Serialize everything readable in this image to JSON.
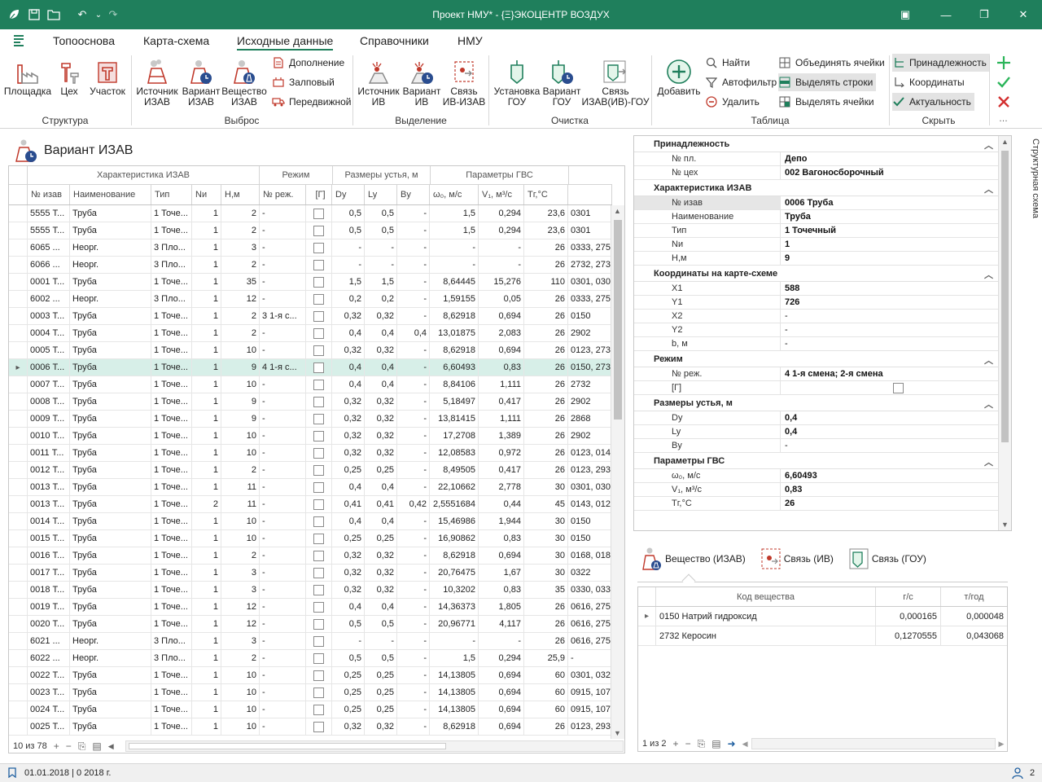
{
  "window": {
    "title": "Проект НМУ* - {Ξ}ЭКОЦЕНТР ВОЗДУХ"
  },
  "menu_tabs": [
    "Топооснова",
    "Карта-схема",
    "Исходные данные",
    "Справочники",
    "НМУ"
  ],
  "ribbon": {
    "groups": {
      "structure": "Структура",
      "emission": "Выброс",
      "selection": "Выделение",
      "cleaning": "Очистка",
      "table": "Таблица",
      "hide": "Скрыть"
    },
    "buttons": {
      "area": "Площадка",
      "shop": "Цех",
      "section": "Участок",
      "source_izav": "Источник ИЗАВ",
      "variant_izav": "Вариант ИЗАВ",
      "substance_izav": "Вещество ИЗАВ",
      "addition": "Дополнение",
      "salvo": "Залповый",
      "mobile": "Передвижной",
      "source_iv": "Источник ИВ",
      "variant_iv": "Вариант ИВ",
      "link_iv_izav": "Связь ИВ-ИЗАВ",
      "install_gou": "Установка ГОУ",
      "variant_gou": "Вариант ГОУ",
      "link_izav_gou": "Связь ИЗАВ(ИВ)-ГОУ",
      "add": "Добавить",
      "find": "Найти",
      "autofilter": "Автофильтр",
      "delete": "Удалить",
      "merge_cells": "Объединять ячейки",
      "select_rows": "Выделять строки",
      "select_cells": "Выделять ячейки",
      "belonging": "Принадлежность",
      "coordinates": "Координаты",
      "actuality": "Актуальность"
    }
  },
  "main": {
    "panel_title": "Вариант ИЗАВ",
    "header_groups": [
      "Характеристика ИЗАВ",
      "Режим",
      "Размеры устья, м",
      "Параметры ГВС"
    ],
    "columns": [
      "№ изав",
      "Наименование",
      "Тип",
      "Nи",
      "Н,м",
      "№ реж.",
      "[Г]",
      "Dy",
      "Ly",
      "By",
      "ω₀, м/с",
      "V₁, м³/с",
      "Тг,°С",
      ""
    ],
    "rows": [
      [
        "5555 Т...",
        "Труба",
        "1 Точе...",
        "1",
        "2",
        "-",
        "",
        "0,5",
        "0,5",
        "-",
        "1,5",
        "0,294",
        "23,6",
        "0301"
      ],
      [
        "5555 Т...",
        "Труба",
        "1 Точе...",
        "1",
        "2",
        "-",
        "",
        "0,5",
        "0,5",
        "-",
        "1,5",
        "0,294",
        "23,6",
        "0301"
      ],
      [
        "6065 ...",
        "Неорг.",
        "3 Пло...",
        "1",
        "3",
        "-",
        "",
        "-",
        "-",
        "-",
        "-",
        "-",
        "26",
        "0333, 275"
      ],
      [
        "6066 ...",
        "Неорг.",
        "3 Пло...",
        "1",
        "2",
        "-",
        "",
        "-",
        "-",
        "-",
        "-",
        "-",
        "26",
        "2732, 273"
      ],
      [
        "0001 Т...",
        "Труба",
        "1 Точе...",
        "1",
        "35",
        "-",
        "",
        "1,5",
        "1,5",
        "-",
        "8,64445",
        "15,276",
        "110",
        "0301, 030"
      ],
      [
        "6002 ...",
        "Неорг.",
        "3 Пло...",
        "1",
        "12",
        "-",
        "",
        "0,2",
        "0,2",
        "-",
        "1,59155",
        "0,05",
        "26",
        "0333, 275"
      ],
      [
        "0003 Т...",
        "Труба",
        "1 Точе...",
        "1",
        "2",
        "3 1-я с...",
        "",
        "0,32",
        "0,32",
        "-",
        "8,62918",
        "0,694",
        "26",
        "0150"
      ],
      [
        "0004 Т...",
        "Труба",
        "1 Точе...",
        "1",
        "2",
        "-",
        "",
        "0,4",
        "0,4",
        "0,4",
        "13,01875",
        "2,083",
        "26",
        "2902"
      ],
      [
        "0005 Т...",
        "Труба",
        "1 Точе...",
        "1",
        "10",
        "-",
        "",
        "0,32",
        "0,32",
        "-",
        "8,62918",
        "0,694",
        "26",
        "0123, 273"
      ],
      [
        "0006 Т...",
        "Труба",
        "1 Точе...",
        "1",
        "9",
        "4 1-я с...",
        "",
        "0,4",
        "0,4",
        "-",
        "6,60493",
        "0,83",
        "26",
        "0150, 273"
      ],
      [
        "0007 Т...",
        "Труба",
        "1 Точе...",
        "1",
        "10",
        "-",
        "",
        "0,4",
        "0,4",
        "-",
        "8,84106",
        "1,111",
        "26",
        "2732"
      ],
      [
        "0008 Т...",
        "Труба",
        "1 Точе...",
        "1",
        "9",
        "-",
        "",
        "0,32",
        "0,32",
        "-",
        "5,18497",
        "0,417",
        "26",
        "2902"
      ],
      [
        "0009 Т...",
        "Труба",
        "1 Точе...",
        "1",
        "9",
        "-",
        "",
        "0,32",
        "0,32",
        "-",
        "13,81415",
        "1,111",
        "26",
        "2868"
      ],
      [
        "0010 Т...",
        "Труба",
        "1 Точе...",
        "1",
        "10",
        "-",
        "",
        "0,32",
        "0,32",
        "-",
        "17,2708",
        "1,389",
        "26",
        "2902"
      ],
      [
        "0011 Т...",
        "Труба",
        "1 Точе...",
        "1",
        "10",
        "-",
        "",
        "0,32",
        "0,32",
        "-",
        "12,08583",
        "0,972",
        "26",
        "0123, 014"
      ],
      [
        "0012 Т...",
        "Труба",
        "1 Точе...",
        "1",
        "2",
        "-",
        "",
        "0,25",
        "0,25",
        "-",
        "8,49505",
        "0,417",
        "26",
        "0123, 293"
      ],
      [
        "0013 Т...",
        "Труба",
        "1 Точе...",
        "1",
        "11",
        "-",
        "",
        "0,4",
        "0,4",
        "-",
        "22,10662",
        "2,778",
        "30",
        "0301, 030"
      ],
      [
        "0013 Т...",
        "Труба",
        "1 Точе...",
        "2",
        "11",
        "-",
        "",
        "0,41",
        "0,41",
        "0,42",
        "2,5551684",
        "0,44",
        "45",
        "0143, 012"
      ],
      [
        "0014 Т...",
        "Труба",
        "1 Точе...",
        "1",
        "10",
        "-",
        "",
        "0,4",
        "0,4",
        "-",
        "15,46986",
        "1,944",
        "30",
        "0150"
      ],
      [
        "0015 Т...",
        "Труба",
        "1 Точе...",
        "1",
        "10",
        "-",
        "",
        "0,25",
        "0,25",
        "-",
        "16,90862",
        "0,83",
        "30",
        "0150"
      ],
      [
        "0016 Т...",
        "Труба",
        "1 Точе...",
        "1",
        "2",
        "-",
        "",
        "0,32",
        "0,32",
        "-",
        "8,62918",
        "0,694",
        "30",
        "0168, 018"
      ],
      [
        "0017 Т...",
        "Труба",
        "1 Точе...",
        "1",
        "3",
        "-",
        "",
        "0,32",
        "0,32",
        "-",
        "20,76475",
        "1,67",
        "30",
        "0322"
      ],
      [
        "0018 Т...",
        "Труба",
        "1 Точе...",
        "1",
        "3",
        "-",
        "",
        "0,32",
        "0,32",
        "-",
        "10,3202",
        "0,83",
        "35",
        "0330, 033"
      ],
      [
        "0019 Т...",
        "Труба",
        "1 Точе...",
        "1",
        "12",
        "-",
        "",
        "0,4",
        "0,4",
        "-",
        "14,36373",
        "1,805",
        "26",
        "0616, 275"
      ],
      [
        "0020 Т...",
        "Труба",
        "1 Точе...",
        "1",
        "12",
        "-",
        "",
        "0,5",
        "0,5",
        "-",
        "20,96771",
        "4,117",
        "26",
        "0616, 275"
      ],
      [
        "6021 ...",
        "Неорг.",
        "3 Пло...",
        "1",
        "3",
        "-",
        "",
        "-",
        "-",
        "-",
        "-",
        "-",
        "26",
        "0616, 275"
      ],
      [
        "6022 ...",
        "Неорг.",
        "3 Пло...",
        "1",
        "2",
        "-",
        "",
        "0,5",
        "0,5",
        "-",
        "1,5",
        "0,294",
        "25,9",
        "-"
      ],
      [
        "0022 Т...",
        "Труба",
        "1 Точе...",
        "1",
        "10",
        "-",
        "",
        "0,25",
        "0,25",
        "-",
        "14,13805",
        "0,694",
        "60",
        "0301, 032"
      ],
      [
        "0023 Т...",
        "Труба",
        "1 Точе...",
        "1",
        "10",
        "-",
        "",
        "0,25",
        "0,25",
        "-",
        "14,13805",
        "0,694",
        "60",
        "0915, 107"
      ],
      [
        "0024 Т...",
        "Труба",
        "1 Точе...",
        "1",
        "10",
        "-",
        "",
        "0,25",
        "0,25",
        "-",
        "14,13805",
        "0,694",
        "60",
        "0915, 107"
      ],
      [
        "0025 Т...",
        "Труба",
        "1 Точе...",
        "1",
        "10",
        "-",
        "",
        "0,32",
        "0,32",
        "-",
        "8,62918",
        "0,694",
        "26",
        "0123, 293"
      ]
    ],
    "selected_row": 9,
    "footer_count": "10 из 78"
  },
  "properties": {
    "sections": [
      {
        "title": "Принадлежность",
        "rows": [
          [
            "№ пл.",
            "Депо"
          ],
          [
            "№ цех",
            "002 Вагоносборочный"
          ]
        ]
      },
      {
        "title": "Характеристика ИЗАВ",
        "rows": [
          [
            "№ изав",
            "0006 Труба"
          ],
          [
            "Наименование",
            "Труба"
          ],
          [
            "Тип",
            "1 Точечный"
          ],
          [
            "Nи",
            "1"
          ],
          [
            "Н,м",
            "9"
          ]
        ]
      },
      {
        "title": "Координаты на карте-схеме",
        "rows": [
          [
            "X1",
            "588"
          ],
          [
            "Y1",
            "726"
          ],
          [
            "X2",
            "-"
          ],
          [
            "Y2",
            "-"
          ],
          [
            "b, м",
            "-"
          ]
        ]
      },
      {
        "title": "Режим",
        "rows": [
          [
            "№ реж.",
            "4 1-я смена; 2-я смена"
          ],
          [
            "[Г]",
            ""
          ]
        ]
      },
      {
        "title": "Размеры устья, м",
        "rows": [
          [
            "Dy",
            "0,4"
          ],
          [
            "Ly",
            "0,4"
          ],
          [
            "By",
            "-"
          ]
        ]
      },
      {
        "title": "Параметры ГВС",
        "rows": [
          [
            "ω₀, м/с",
            "6,60493"
          ],
          [
            "V₁, м³/с",
            "0,83"
          ],
          [
            "Тг,°С",
            "26"
          ]
        ]
      }
    ]
  },
  "side_tab": "Структурная схема",
  "bottom": {
    "tabs": [
      "Вещество (ИЗАВ)",
      "Связь (ИВ)",
      "Связь (ГОУ)"
    ],
    "columns": [
      "Код вещества",
      "г/с",
      "т/год"
    ],
    "rows": [
      [
        "0150 Натрий гидроксид",
        "0,000165",
        "0,000048"
      ],
      [
        "2732 Керосин",
        "0,1270555",
        "0,043068"
      ]
    ],
    "footer_count": "1 из 2"
  },
  "status": {
    "text": "01.01.2018 | 0 2018 г.",
    "count": "2"
  },
  "colors": {
    "accent": "#1f7f5c",
    "selection": "#d7efe8",
    "icon_red": "#c0392b",
    "icon_blue": "#2a4d8f"
  }
}
